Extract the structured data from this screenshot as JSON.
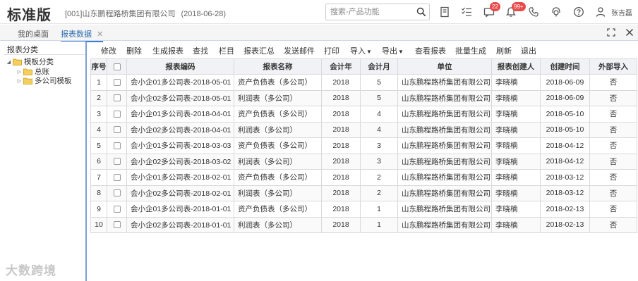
{
  "header": {
    "app_title": "标准版",
    "company": "[001]山东鹏程路桥集团有限公司",
    "date": "(2018-06-28)",
    "search_placeholder": "搜索-产品功能",
    "messages_badge": "22",
    "notifications_badge": "99+",
    "username": "张吉磊"
  },
  "tabs": [
    {
      "label": "我的桌面",
      "active": false
    },
    {
      "label": "报表数据",
      "active": true
    }
  ],
  "sidebar": {
    "title": "报表分类",
    "tree": {
      "root": "模板分类",
      "children": [
        "总账",
        "多公司模板"
      ]
    }
  },
  "toolbar": {
    "buttons": [
      "修改",
      "删除",
      "生成报表",
      "查找",
      "栏目",
      "报表汇总",
      "发送邮件",
      "打印",
      "导入",
      "导出",
      "查看报表",
      "批量生成",
      "刷新",
      "退出"
    ]
  },
  "table": {
    "columns": [
      "序号",
      "",
      "报表编码",
      "报表名称",
      "会计年",
      "会计月",
      "单位",
      "报表创建人",
      "创建时间",
      "外部导入"
    ],
    "rows": [
      [
        "1",
        "会小企01多公司表-2018-05-01",
        "资产负债表（多公司）",
        "2018",
        "5",
        "山东鹏程路桥集团有限公司",
        "李晓楠",
        "2018-06-09",
        "否"
      ],
      [
        "2",
        "会小企02多公司表-2018-05-01",
        "利润表（多公司）",
        "2018",
        "5",
        "山东鹏程路桥集团有限公司",
        "李晓楠",
        "2018-06-09",
        "否"
      ],
      [
        "3",
        "会小企01多公司表-2018-04-01",
        "资产负债表（多公司）",
        "2018",
        "4",
        "山东鹏程路桥集团有限公司",
        "李晓楠",
        "2018-05-10",
        "否"
      ],
      [
        "4",
        "会小企02多公司表-2018-04-01",
        "利润表（多公司）",
        "2018",
        "4",
        "山东鹏程路桥集团有限公司",
        "李晓楠",
        "2018-05-10",
        "否"
      ],
      [
        "5",
        "会小企01多公司表-2018-03-03",
        "资产负债表（多公司）",
        "2018",
        "3",
        "山东鹏程路桥集团有限公司",
        "李晓楠",
        "2018-04-12",
        "否"
      ],
      [
        "6",
        "会小企02多公司表-2018-03-02",
        "利润表（多公司）",
        "2018",
        "3",
        "山东鹏程路桥集团有限公司",
        "李晓楠",
        "2018-04-12",
        "否"
      ],
      [
        "7",
        "会小企01多公司表-2018-02-01",
        "资产负债表（多公司）",
        "2018",
        "2",
        "山东鹏程路桥集团有限公司",
        "李晓楠",
        "2018-03-12",
        "否"
      ],
      [
        "8",
        "会小企02多公司表-2018-02-01",
        "利润表（多公司）",
        "2018",
        "2",
        "山东鹏程路桥集团有限公司",
        "李晓楠",
        "2018-03-12",
        "否"
      ],
      [
        "9",
        "会小企01多公司表-2018-01-01",
        "资产负债表（多公司）",
        "2018",
        "1",
        "山东鹏程路桥集团有限公司",
        "李晓楠",
        "2018-02-13",
        "否"
      ],
      [
        "10",
        "会小企02多公司表-2018-01-01",
        "利润表（多公司）",
        "2018",
        "1",
        "山东鹏程路桥集团有限公司",
        "李晓楠",
        "2018-02-13",
        "否"
      ]
    ]
  },
  "watermark": "大数跨境",
  "colors": {
    "accent": "#3a7bd5",
    "badge": "#e84b4b",
    "header_bg": "#f0f2f5"
  }
}
